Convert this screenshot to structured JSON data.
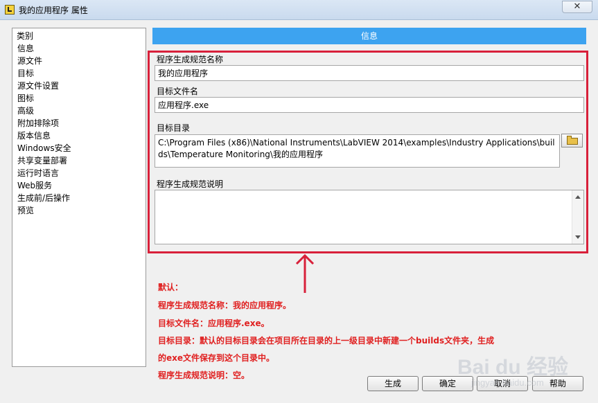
{
  "window": {
    "title": "我的应用程序 属性",
    "close_label": "✕"
  },
  "sidebar": {
    "header": "类别",
    "items": [
      "信息",
      "源文件",
      "目标",
      "源文件设置",
      "图标",
      "高级",
      "附加排除项",
      "版本信息",
      "Windows安全",
      "共享变量部署",
      "运行时语言",
      "Web服务",
      "生成前/后操作",
      "预览"
    ],
    "selected_index": 0
  },
  "main": {
    "section_title": "信息",
    "build_name": {
      "label": "程序生成规范名称",
      "value": "我的应用程序"
    },
    "target_file": {
      "label": "目标文件名",
      "value": "应用程序.exe"
    },
    "target_dir": {
      "label": "目标目录",
      "value": "C:\\Program Files (x86)\\National Instruments\\LabVIEW 2014\\examples\\Industry Applications\\builds\\Temperature Monitoring\\我的应用程序"
    },
    "description": {
      "label": "程序生成规范说明",
      "value": ""
    }
  },
  "annotation": {
    "lines": [
      "默认：",
      "程序生成规范名称：我的应用程序。",
      "目标文件名：应用程序.exe。",
      "目标目录：默认的目标目录会在项目所在目录的上一级目录中新建一个builds文件夹，生成",
      "的exe文件保存到这个目录中。",
      "程序生成规范说明：空。"
    ],
    "color": "#e02020"
  },
  "buttons": {
    "build": "生成",
    "ok": "确定",
    "cancel": "取消",
    "help": "帮助"
  },
  "watermark": {
    "brand": "Bai du 经验",
    "url": "jingyan.baidu.com"
  },
  "colors": {
    "accent": "#3da3f0",
    "highlight": "#d8203a",
    "selection": "#3399ff"
  }
}
